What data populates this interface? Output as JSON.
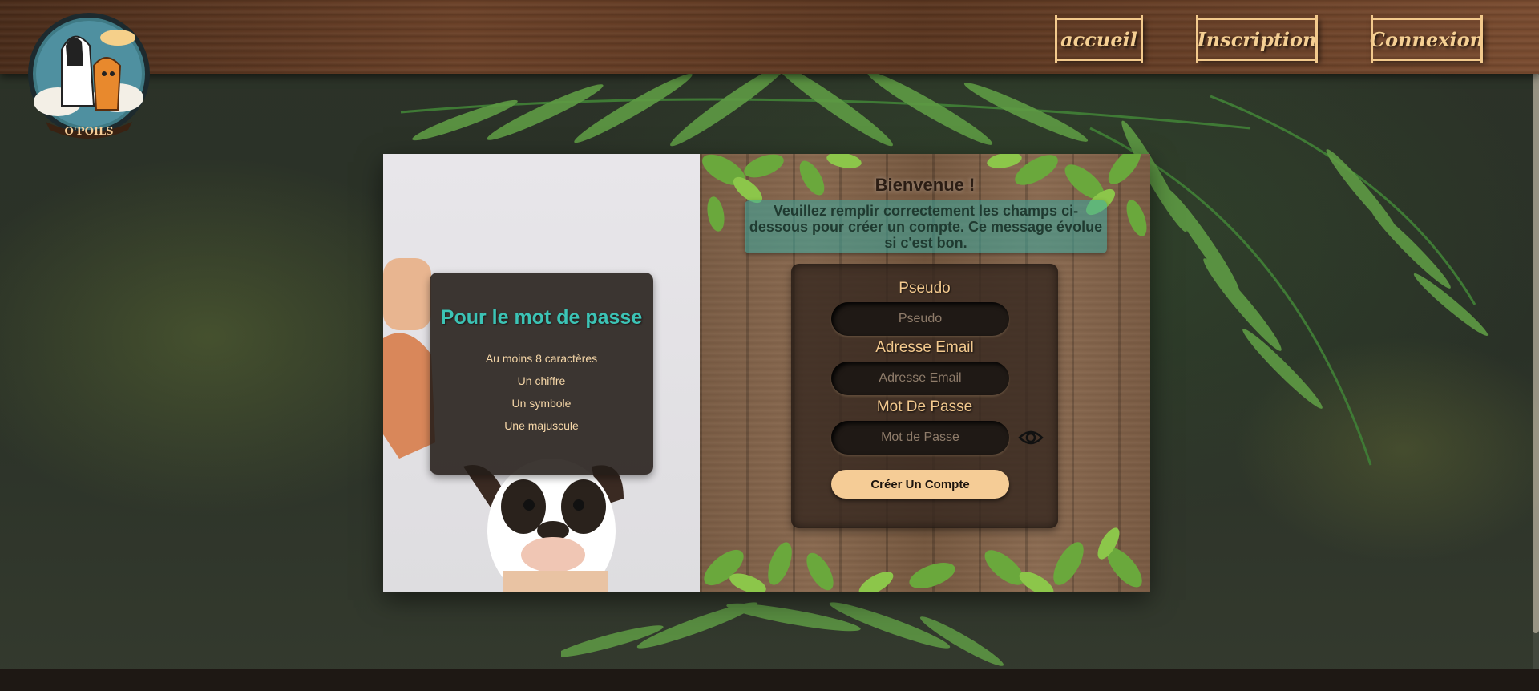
{
  "header": {
    "logo_text": "O'POILS",
    "nav": [
      {
        "label": "accueil"
      },
      {
        "label": "Inscription"
      },
      {
        "label": "Connexion"
      }
    ]
  },
  "password_rules": {
    "title": "Pour le mot de passe",
    "items": [
      "Au moins 8 caractères",
      "Un chiffre",
      "Un symbole",
      "Une majuscule"
    ]
  },
  "register": {
    "welcome": "Bienvenue !",
    "message": "Veuillez remplir correctement les champs ci-dessous pour créer un compte. Ce message évolue si c'est bon.",
    "fields": [
      {
        "label": "Pseudo",
        "placeholder": "Pseudo"
      },
      {
        "label": "Adresse Email",
        "placeholder": "Adresse Email"
      },
      {
        "label": "Mot De Passe",
        "placeholder": "Mot de Passe"
      }
    ],
    "toggle_icon": "eye-icon",
    "submit_label": "Créer Un Compte"
  },
  "colors": {
    "accent_teal": "#3cc3b5",
    "tan": "#f5cc96",
    "wood_dark": "#4a2c1a"
  }
}
